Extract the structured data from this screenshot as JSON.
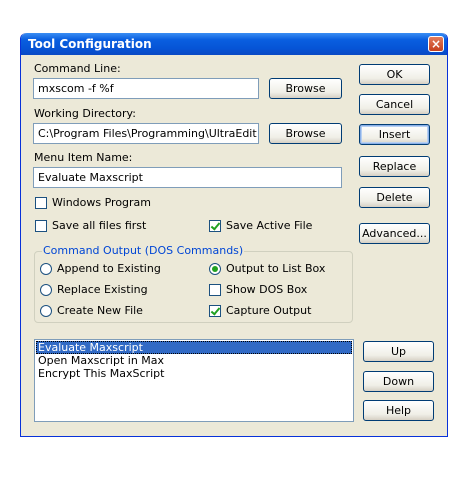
{
  "window": {
    "title": "Tool Configuration",
    "close_glyph": "×"
  },
  "command_line": {
    "label": "Command Line:",
    "value": "mxscom -f %f",
    "browse": "Browse"
  },
  "working_dir": {
    "label": "Working Directory:",
    "value": "C:\\Program Files\\Programming\\UltraEdit",
    "browse": "Browse"
  },
  "menu_item": {
    "label": "Menu Item Name:",
    "value": "Evaluate Maxscript"
  },
  "options": {
    "windows_program": {
      "label": "Windows Program",
      "checked": false
    },
    "save_all": {
      "label": "Save all files first",
      "checked": false
    },
    "save_active": {
      "label": "Save Active File",
      "checked": true
    }
  },
  "output_group": {
    "label": "Command Output (DOS Commands)",
    "append": {
      "label": "Append to Existing",
      "selected": false
    },
    "replace": {
      "label": "Replace Existing",
      "selected": false
    },
    "create_new": {
      "label": "Create New File",
      "selected": false
    },
    "list_box": {
      "label": "Output to List Box",
      "selected": true
    },
    "show_dos": {
      "label": "Show DOS Box",
      "checked": false
    },
    "capture": {
      "label": "Capture Output",
      "checked": true
    }
  },
  "buttons": {
    "ok": "OK",
    "cancel": "Cancel",
    "insert": "Insert",
    "replace": "Replace",
    "delete": "Delete",
    "advanced": "Advanced...",
    "up": "Up",
    "down": "Down",
    "help": "Help"
  },
  "tools": [
    "Evaluate Maxscript",
    "Open Maxscript in Max",
    "Encrypt This MaxScript"
  ]
}
